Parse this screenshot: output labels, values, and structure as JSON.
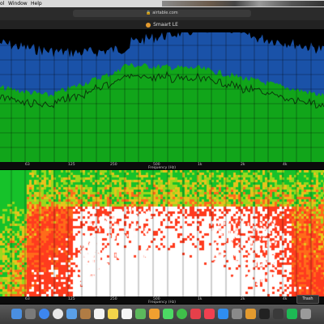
{
  "menubar": {
    "items": [
      "ol",
      "Window",
      "Help"
    ]
  },
  "browser": {
    "url": "airtable.com"
  },
  "window": {
    "title": "Smaart LE"
  },
  "spectrum_axis": {
    "ticks": [
      "63",
      "125",
      "250",
      "500",
      "1k",
      "2k",
      "4k"
    ],
    "label": "Frequency (Hz)"
  },
  "spectrogram_axis": {
    "ticks": [
      "63",
      "125",
      "250",
      "500",
      "1k",
      "2k",
      "4k"
    ],
    "label": "Frequency (Hz)"
  },
  "trash_button": {
    "label": "Trash"
  },
  "dock": {
    "icons": [
      "finder-icon",
      "launchpad-icon",
      "safari-icon",
      "chrome-icon",
      "mail-icon",
      "contacts-icon",
      "calendar-icon",
      "notes-icon",
      "reminders-icon",
      "maps-icon",
      "photos-icon",
      "messages-icon",
      "facetime-icon",
      "news-icon",
      "music-icon",
      "appstore-icon",
      "preferences-icon",
      "smaart-icon",
      "terminal-icon",
      "activity-icon",
      "spotify-icon",
      "trash-dock-icon"
    ],
    "colors": [
      "#4a8fe0",
      "#7a7a7a",
      "#3d86f0",
      "#e8e8e8",
      "#5aa0e8",
      "#b07c44",
      "#f4f4f4",
      "#f3d34a",
      "#f5f5f5",
      "#5cb85c",
      "#f0a030",
      "#4cd964",
      "#3fbf4a",
      "#e5404a",
      "#f04050",
      "#2f8ef0",
      "#8a8a8a",
      "#e39a2e",
      "#222222",
      "#3a3a3a",
      "#1db954",
      "#9a9a9a"
    ]
  },
  "colors": {
    "spectrum_green": "#11a51a",
    "spectrum_blue": "#1a52a8",
    "grid": "#000000"
  }
}
